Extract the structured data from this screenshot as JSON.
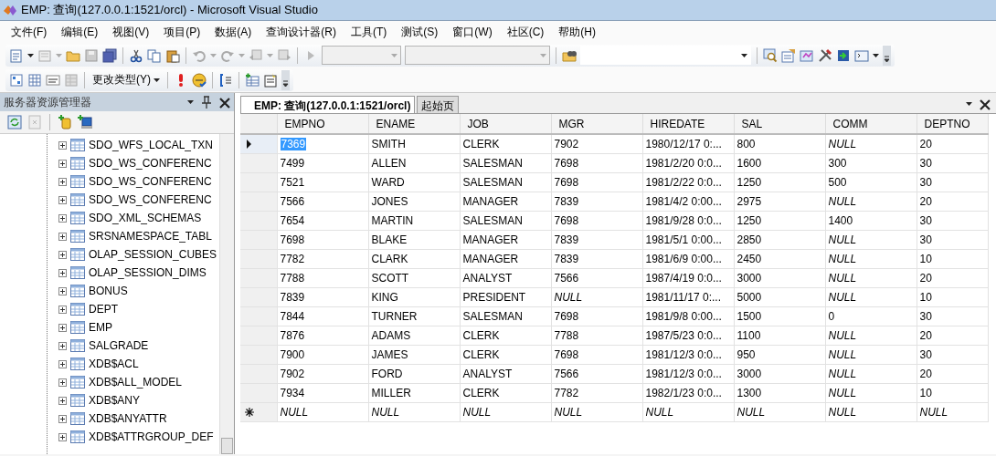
{
  "window": {
    "title": "EMP: 查询(127.0.0.1:1521/orcl) - Microsoft Visual Studio"
  },
  "menu": [
    "文件(F)",
    "编辑(E)",
    "视图(V)",
    "项目(P)",
    "数据(A)",
    "查询设计器(R)",
    "工具(T)",
    "测试(S)",
    "窗口(W)",
    "社区(C)",
    "帮助(H)"
  ],
  "toolbar2": {
    "change_type_button": "更改类型(Y)"
  },
  "server_explorer": {
    "title": "服务器资源管理器",
    "items": [
      {
        "label": "SDO_WFS_LOCAL_TXN",
        "expanded": false
      },
      {
        "label": "SDO_WS_CONFERENC",
        "expanded": false
      },
      {
        "label": "SDO_WS_CONFERENC",
        "expanded": false
      },
      {
        "label": "SDO_WS_CONFERENC",
        "expanded": false
      },
      {
        "label": "SDO_XML_SCHEMAS",
        "expanded": false
      },
      {
        "label": "SRSNAMESPACE_TABL",
        "expanded": false
      },
      {
        "label": "OLAP_SESSION_CUBES",
        "expanded": false
      },
      {
        "label": "OLAP_SESSION_DIMS",
        "expanded": false
      },
      {
        "label": "BONUS",
        "expanded": false
      },
      {
        "label": "DEPT",
        "expanded": false
      },
      {
        "label": "EMP",
        "expanded": false
      },
      {
        "label": "SALGRADE",
        "expanded": false
      },
      {
        "label": "XDB$ACL",
        "expanded": false
      },
      {
        "label": "XDB$ALL_MODEL",
        "expanded": false
      },
      {
        "label": "XDB$ANY",
        "expanded": false
      },
      {
        "label": "XDB$ANYATTR",
        "expanded": false
      },
      {
        "label": "XDB$ATTRGROUP_DEF",
        "expanded": false
      }
    ]
  },
  "tabs": [
    {
      "label": "EMP: 查询(127.0.0.1:1521/orcl)",
      "selected": true
    },
    {
      "label": "起始页",
      "selected": false
    }
  ],
  "table": {
    "columns": [
      "EMPNO",
      "ENAME",
      "JOB",
      "MGR",
      "HIREDATE",
      "SAL",
      "COMM",
      "DEPTNO"
    ],
    "rows": [
      {
        "kind": "data",
        "current": true,
        "cells": [
          {
            "text": "7369",
            "selected": true
          },
          "SMITH",
          "CLERK",
          "7902",
          "1980/12/17 0:...",
          "800",
          {
            "text": "NULL",
            "null": true
          },
          "20"
        ]
      },
      {
        "kind": "data",
        "current": false,
        "cells": [
          "7499",
          "ALLEN",
          "SALESMAN",
          "7698",
          "1981/2/20 0:0...",
          "1600",
          "300",
          "30"
        ]
      },
      {
        "kind": "data",
        "current": false,
        "cells": [
          "7521",
          "WARD",
          "SALESMAN",
          "7698",
          "1981/2/22 0:0...",
          "1250",
          "500",
          "30"
        ]
      },
      {
        "kind": "data",
        "current": false,
        "cells": [
          "7566",
          "JONES",
          "MANAGER",
          "7839",
          "1981/4/2 0:00...",
          "2975",
          {
            "text": "NULL",
            "null": true
          },
          "20"
        ]
      },
      {
        "kind": "data",
        "current": false,
        "cells": [
          "7654",
          "MARTIN",
          "SALESMAN",
          "7698",
          "1981/9/28 0:0...",
          "1250",
          "1400",
          "30"
        ]
      },
      {
        "kind": "data",
        "current": false,
        "cells": [
          "7698",
          "BLAKE",
          "MANAGER",
          "7839",
          "1981/5/1 0:00...",
          "2850",
          {
            "text": "NULL",
            "null": true
          },
          "30"
        ]
      },
      {
        "kind": "data",
        "current": false,
        "cells": [
          "7782",
          "CLARK",
          "MANAGER",
          "7839",
          "1981/6/9 0:00...",
          "2450",
          {
            "text": "NULL",
            "null": true
          },
          "10"
        ]
      },
      {
        "kind": "data",
        "current": false,
        "cells": [
          "7788",
          "SCOTT",
          "ANALYST",
          "7566",
          "1987/4/19 0:0...",
          "3000",
          {
            "text": "NULL",
            "null": true
          },
          "20"
        ]
      },
      {
        "kind": "data",
        "current": false,
        "cells": [
          "7839",
          "KING",
          "PRESIDENT",
          {
            "text": "NULL",
            "null": true
          },
          "1981/11/17 0:...",
          "5000",
          {
            "text": "NULL",
            "null": true
          },
          "10"
        ]
      },
      {
        "kind": "data",
        "current": false,
        "cells": [
          "7844",
          "TURNER",
          "SALESMAN",
          "7698",
          "1981/9/8 0:00...",
          "1500",
          "0",
          "30"
        ]
      },
      {
        "kind": "data",
        "current": false,
        "cells": [
          "7876",
          "ADAMS",
          "CLERK",
          "7788",
          "1987/5/23 0:0...",
          "1100",
          {
            "text": "NULL",
            "null": true
          },
          "20"
        ]
      },
      {
        "kind": "data",
        "current": false,
        "cells": [
          "7900",
          "JAMES",
          "CLERK",
          "7698",
          "1981/12/3 0:0...",
          "950",
          {
            "text": "NULL",
            "null": true
          },
          "30"
        ]
      },
      {
        "kind": "data",
        "current": false,
        "cells": [
          "7902",
          "FORD",
          "ANALYST",
          "7566",
          "1981/12/3 0:0...",
          "3000",
          {
            "text": "NULL",
            "null": true
          },
          "20"
        ]
      },
      {
        "kind": "data",
        "current": false,
        "cells": [
          "7934",
          "MILLER",
          "CLERK",
          "7782",
          "1982/1/23 0:0...",
          "1300",
          {
            "text": "NULL",
            "null": true
          },
          "10"
        ]
      },
      {
        "kind": "new",
        "current": false,
        "cells": [
          {
            "text": "NULL",
            "null": true
          },
          {
            "text": "NULL",
            "null": true
          },
          {
            "text": "NULL",
            "null": true
          },
          {
            "text": "NULL",
            "null": true
          },
          {
            "text": "NULL",
            "null": true
          },
          {
            "text": "NULL",
            "null": true
          },
          {
            "text": "NULL",
            "null": true
          },
          {
            "text": "NULL",
            "null": true
          }
        ]
      }
    ]
  }
}
